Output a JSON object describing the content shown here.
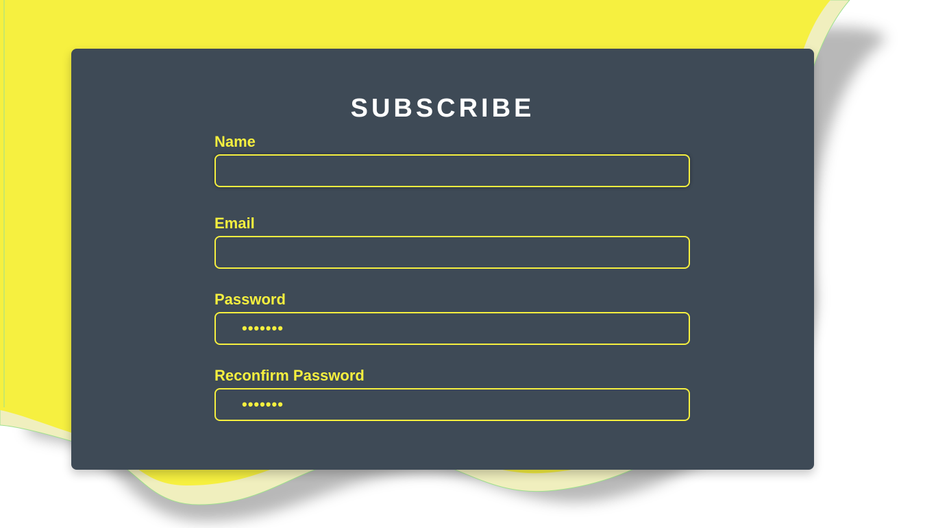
{
  "colors": {
    "accent": "#f5ef3f",
    "card_background": "#3e4a56",
    "title_text": "#ffffff",
    "page_background": "#ffffff"
  },
  "form": {
    "title": "SUBSCRIBE",
    "fields": [
      {
        "label": "Name",
        "value": "",
        "type": "text"
      },
      {
        "label": "Email",
        "value": "",
        "type": "email"
      },
      {
        "label": "Password",
        "value": "•••••••",
        "type": "password"
      },
      {
        "label": "Reconfirm Password",
        "value": "•••••••",
        "type": "password"
      }
    ]
  }
}
